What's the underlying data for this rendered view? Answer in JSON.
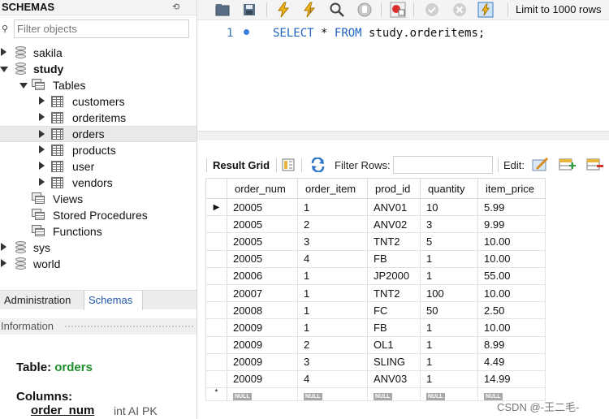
{
  "sidebar": {
    "title": "SCHEMAS",
    "filter_placeholder": "Filter objects",
    "tree": {
      "sakila": "sakila",
      "study": "study",
      "tables": "Tables",
      "table_items": [
        "customers",
        "orderitems",
        "orders",
        "products",
        "user",
        "vendors"
      ],
      "views": "Views",
      "procedures": "Stored Procedures",
      "functions": "Functions",
      "sys": "sys",
      "world": "world"
    },
    "tabs": [
      "Administration",
      "Schemas"
    ],
    "info_title": "Information",
    "info": {
      "table_label": "Table:",
      "table_name": "orders",
      "columns_label": "Columns:",
      "col_name": "order_num",
      "col_meta": "int AI PK"
    }
  },
  "toolbar": {
    "limit_label": "Limit to 1000 rows"
  },
  "editor": {
    "line_no": "1",
    "kw_select": "SELECT",
    "star": "*",
    "kw_from": "FROM",
    "table": "study.orderitems;"
  },
  "result": {
    "grid_label": "Result Grid",
    "filter_label": "Filter Rows:",
    "edit_label": "Edit:",
    "columns": [
      "order_num",
      "order_item",
      "prod_id",
      "quantity",
      "item_price"
    ],
    "rows": [
      [
        "20005",
        "1",
        "ANV01",
        "10",
        "5.99"
      ],
      [
        "20005",
        "2",
        "ANV02",
        "3",
        "9.99"
      ],
      [
        "20005",
        "3",
        "TNT2",
        "5",
        "10.00"
      ],
      [
        "20005",
        "4",
        "FB",
        "1",
        "10.00"
      ],
      [
        "20006",
        "1",
        "JP2000",
        "1",
        "55.00"
      ],
      [
        "20007",
        "1",
        "TNT2",
        "100",
        "10.00"
      ],
      [
        "20008",
        "1",
        "FC",
        "50",
        "2.50"
      ],
      [
        "20009",
        "1",
        "FB",
        "1",
        "10.00"
      ],
      [
        "20009",
        "2",
        "OL1",
        "1",
        "8.99"
      ],
      [
        "20009",
        "3",
        "SLING",
        "1",
        "4.49"
      ],
      [
        "20009",
        "4",
        "ANV03",
        "1",
        "14.99"
      ]
    ],
    "null_text": "NULL"
  },
  "watermark": "CSDN @-王二毛-",
  "colors": {
    "accent": "#1f58a8",
    "keyword": "#1e62c4",
    "table_name": "#1f8f2d"
  }
}
